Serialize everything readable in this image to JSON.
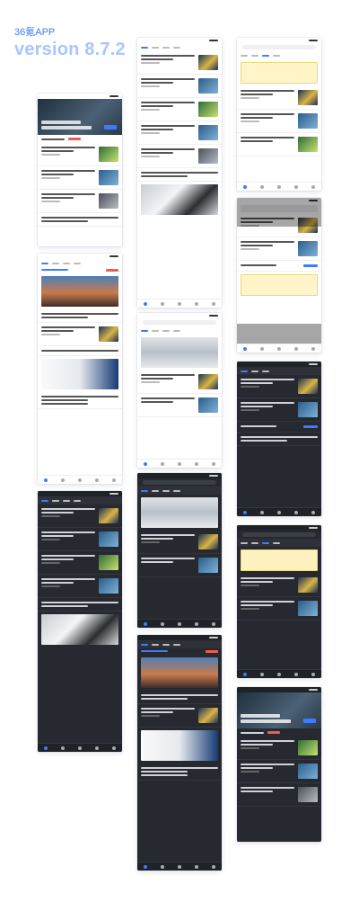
{
  "header": {
    "brand": "36氪APP",
    "version": "version 8.7.2"
  },
  "colors": {
    "accent": "#3d7bff",
    "dark_bg": "#26292f",
    "highlight": "#fff5c9",
    "tag_red": "#f05a4f"
  },
  "screens": [
    {
      "id": "light-home-hero",
      "theme": "light"
    },
    {
      "id": "light-feed",
      "theme": "light"
    },
    {
      "id": "light-notice",
      "theme": "light"
    },
    {
      "id": "light-ad-feed",
      "theme": "light"
    },
    {
      "id": "light-city-feed",
      "theme": "light"
    },
    {
      "id": "light-dim-overlay",
      "theme": "light"
    },
    {
      "id": "dark-feed",
      "theme": "dark"
    },
    {
      "id": "dark-city-feed",
      "theme": "dark"
    },
    {
      "id": "dark-list",
      "theme": "dark"
    },
    {
      "id": "dark-notice",
      "theme": "dark"
    },
    {
      "id": "dark-ad-feed",
      "theme": "dark"
    },
    {
      "id": "dark-hero",
      "theme": "dark"
    }
  ]
}
